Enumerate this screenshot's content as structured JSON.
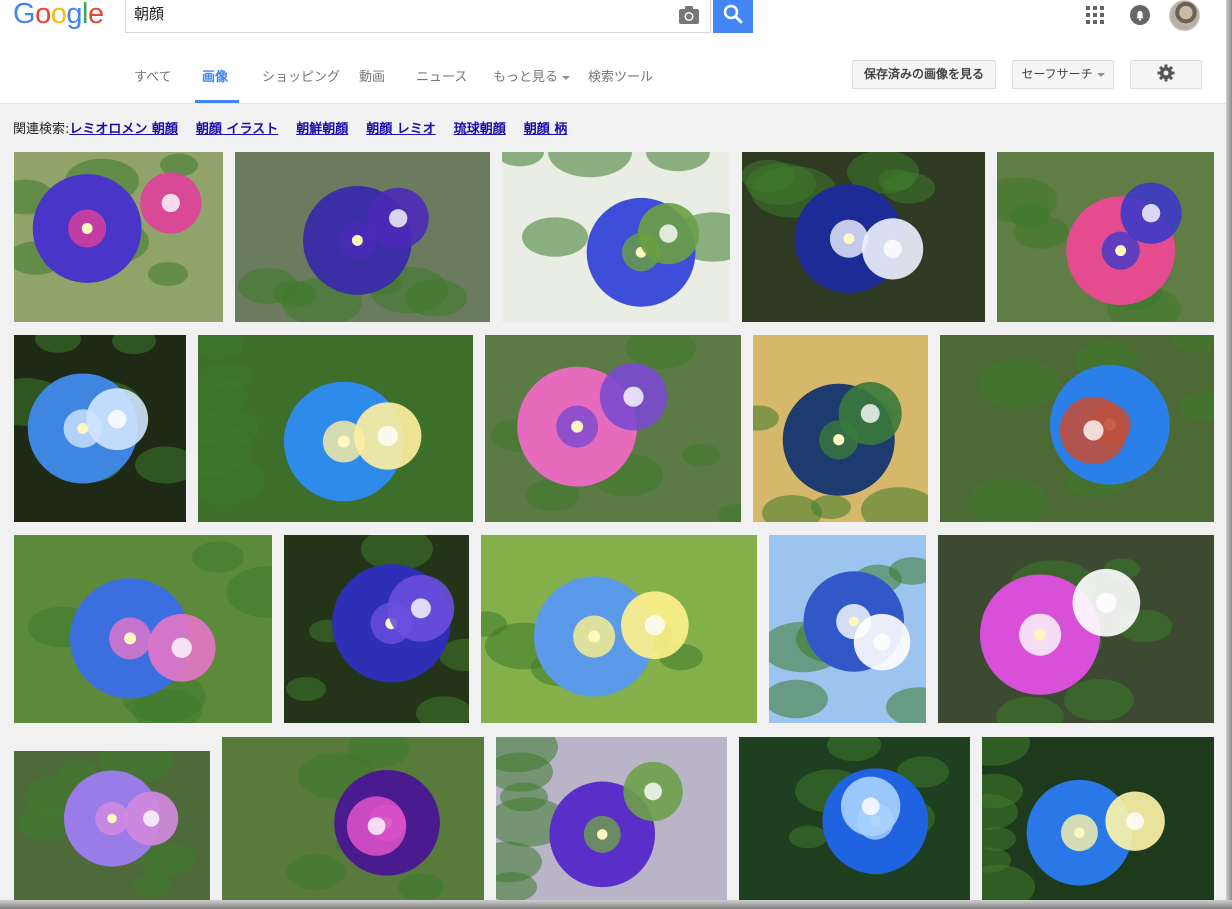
{
  "header": {
    "logo_text": "Google",
    "search_query": "朝顔"
  },
  "nav": {
    "tabs": [
      {
        "label": "すべて",
        "active": false
      },
      {
        "label": "画像",
        "active": true
      },
      {
        "label": "ショッピング",
        "active": false
      },
      {
        "label": "動画",
        "active": false
      },
      {
        "label": "ニュース",
        "active": false
      },
      {
        "label": "もっと見る",
        "active": false
      },
      {
        "label": "検索ツール",
        "active": false
      }
    ],
    "saved_images_label": "保存済みの画像を見る",
    "safesearch_label": "セーフサーチ"
  },
  "related": {
    "label": "関連検索:",
    "items": [
      "レミオロメン 朝顔",
      "朝顔 イラスト",
      "朝鮮朝顔",
      "朝顔 レミオ",
      "琉球朝顔",
      "朝顔 柄"
    ]
  },
  "colors": {
    "accent": "#4285f4",
    "link": "#1a0dab",
    "logo": [
      "#4285f4",
      "#ea4335",
      "#fbbc05",
      "#4285f4",
      "#34a853",
      "#ea4335"
    ]
  },
  "icons": [
    "camera-icon",
    "search-icon",
    "apps-icon",
    "notifications-icon",
    "settings-icon",
    "caret-down-icon"
  ]
}
